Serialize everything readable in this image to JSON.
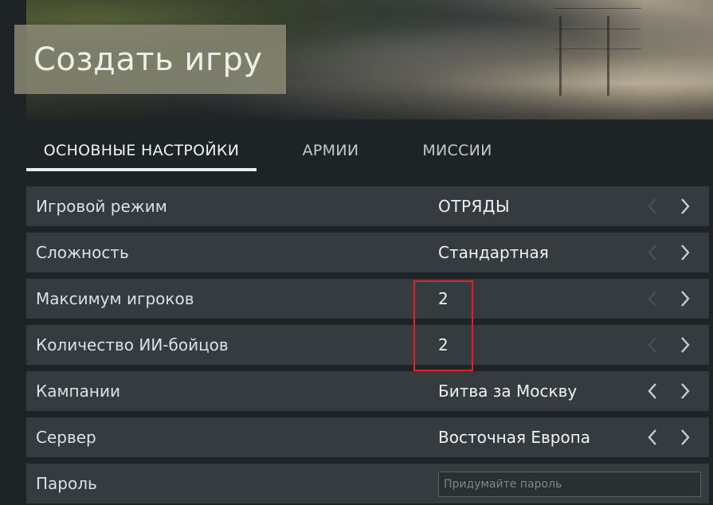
{
  "header": {
    "title": "Создать игру"
  },
  "tabs": [
    {
      "label": "ОСНОВНЫЕ НАСТРОЙКИ",
      "active": true
    },
    {
      "label": "АРМИИ",
      "active": false
    },
    {
      "label": "МИССИИ",
      "active": false
    }
  ],
  "settings": {
    "game_mode": {
      "label": "Игровой режим",
      "value": "ОТРЯДЫ"
    },
    "difficulty": {
      "label": "Сложность",
      "value": "Стандартная"
    },
    "max_players": {
      "label": "Максимум игроков",
      "value": "2"
    },
    "ai_count": {
      "label": "Количество ИИ-бойцов",
      "value": "2"
    },
    "campaigns": {
      "label": "Кампании",
      "value": "Битва за Москву"
    },
    "server": {
      "label": "Сервер",
      "value": "Восточная Европа"
    },
    "password": {
      "label": "Пароль",
      "value": "",
      "placeholder": "Придумайте пароль"
    }
  },
  "icons": {
    "prev": "chevron-left-icon",
    "next": "chevron-right-icon"
  },
  "colors": {
    "background": "#1e2326",
    "row": "#353b3e",
    "title_box": "#8c8c76",
    "highlight": "#e0202a",
    "arrow_active": "#c8cdcf",
    "arrow_dim": "#4b5256"
  }
}
